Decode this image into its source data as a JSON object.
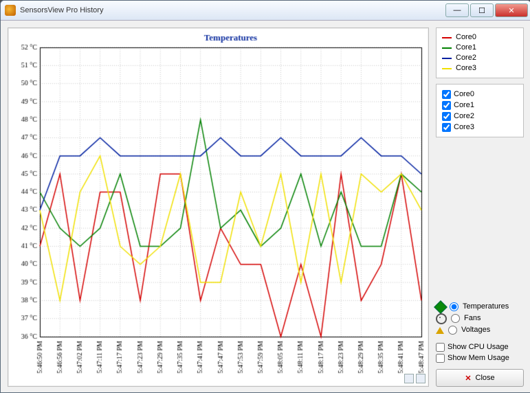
{
  "window": {
    "title": "SensorsView Pro History"
  },
  "chart_data": {
    "type": "line",
    "title": "Temperatures",
    "xlabel": "",
    "ylabel": "",
    "ylim": [
      36,
      52
    ],
    "yticks": [
      36,
      37,
      38,
      39,
      40,
      41,
      42,
      43,
      44,
      45,
      46,
      47,
      48,
      49,
      50,
      51,
      52
    ],
    "yticklabels": [
      "36 °C",
      "37 °C",
      "38 °C",
      "39 °C",
      "40 °C",
      "41 °C",
      "42 °C",
      "43 °C",
      "44 °C",
      "45 °C",
      "46 °C",
      "47 °C",
      "48 °C",
      "49 °C",
      "50 °C",
      "51 °C",
      "52 °C"
    ],
    "categories": [
      "5:46:50 PM",
      "5:46:56 PM",
      "5:47:02 PM",
      "5:47:11 PM",
      "5:47:17 PM",
      "5:47:23 PM",
      "5:47:29 PM",
      "5:47:35 PM",
      "5:47:41 PM",
      "5:47:47 PM",
      "5:47:53 PM",
      "5:47:59 PM",
      "5:48:05 PM",
      "5:48:11 PM",
      "5:48:17 PM",
      "5:48:23 PM",
      "5:48:29 PM",
      "5:48:35 PM",
      "5:48:41 PM",
      "5:48:47 PM"
    ],
    "series": [
      {
        "name": "Core0",
        "color": "#d40000",
        "values": [
          41,
          45,
          38,
          44,
          44,
          38,
          45,
          45,
          38,
          42,
          40,
          40,
          36,
          40,
          36,
          45,
          38,
          40,
          45,
          38
        ]
      },
      {
        "name": "Core1",
        "color": "#008000",
        "values": [
          44,
          42,
          41,
          42,
          45,
          41,
          41,
          42,
          48,
          42,
          43,
          41,
          42,
          45,
          41,
          44,
          41,
          41,
          45,
          44
        ]
      },
      {
        "name": "Core2",
        "color": "#0020a0",
        "values": [
          43,
          46,
          46,
          47,
          46,
          46,
          46,
          46,
          46,
          47,
          46,
          46,
          47,
          46,
          46,
          46,
          47,
          46,
          46,
          45
        ]
      },
      {
        "name": "Core3",
        "color": "#f0e000",
        "values": [
          43,
          38,
          44,
          46,
          41,
          40,
          41,
          45,
          39,
          39,
          44,
          41,
          45,
          39,
          45,
          39,
          45,
          44,
          45,
          43
        ]
      }
    ],
    "grid": true,
    "legend_position": "right"
  },
  "legend": {
    "items": [
      {
        "label": "Core0",
        "color": "#d40000"
      },
      {
        "label": "Core1",
        "color": "#008000"
      },
      {
        "label": "Core2",
        "color": "#0020a0"
      },
      {
        "label": "Core3",
        "color": "#f0e000"
      }
    ]
  },
  "checks": {
    "items": [
      {
        "label": "Core0",
        "checked": true
      },
      {
        "label": "Core1",
        "checked": true
      },
      {
        "label": "Core2",
        "checked": true
      },
      {
        "label": "Core3",
        "checked": true
      }
    ]
  },
  "radios": {
    "items": [
      {
        "label": "Temperatures",
        "checked": true,
        "glyph": "temp",
        "glyph_color": "#0a8a0a"
      },
      {
        "label": "Fans",
        "checked": false,
        "glyph": "fan",
        "glyph_color": "#555"
      },
      {
        "label": "Voltages",
        "checked": false,
        "glyph": "voltage",
        "glyph_color": "#d9a400"
      }
    ]
  },
  "extra_checks": {
    "items": [
      {
        "label": "Show CPU Usage",
        "checked": false
      },
      {
        "label": "Show Mem Usage",
        "checked": false
      }
    ]
  },
  "buttons": {
    "close": "Close"
  }
}
